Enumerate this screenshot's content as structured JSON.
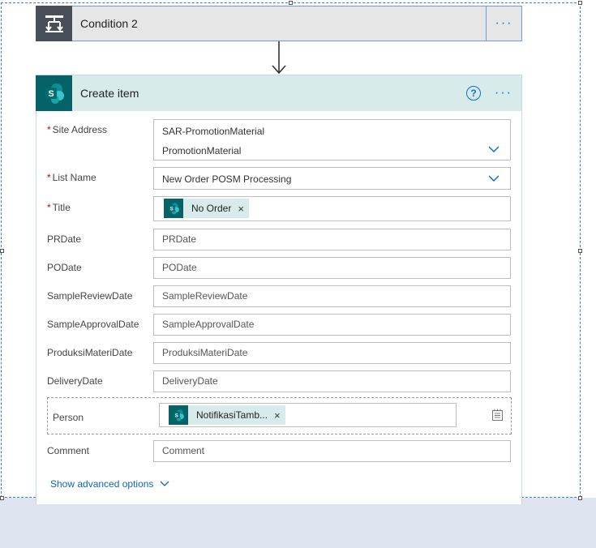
{
  "colors": {
    "accent": "#0e6ed3",
    "sharepoint": "#056367",
    "header_bg": "#d8ebeb",
    "required": "#cc0000"
  },
  "condition": {
    "title": "Condition 2",
    "icon": "condition-icon",
    "more": "···"
  },
  "action": {
    "title": "Create item",
    "icon": "sharepoint-icon",
    "help": "?",
    "more": "···",
    "fields": {
      "site_address": {
        "label": "Site Address",
        "line1": "SAR-PromotionMaterial",
        "line2": "PromotionMaterial"
      },
      "list_name": {
        "label": "List Name",
        "value": "New Order POSM Processing"
      },
      "title": {
        "label": "Title",
        "token": "No Order",
        "remove": "×"
      },
      "prdate": {
        "label": "PRDate",
        "placeholder": "PRDate"
      },
      "podate": {
        "label": "PODate",
        "placeholder": "PODate"
      },
      "sample_review": {
        "label": "SampleReviewDate",
        "placeholder": "SampleReviewDate"
      },
      "sample_approval": {
        "label": "SampleApprovalDate",
        "placeholder": "SampleApprovalDate"
      },
      "produksi": {
        "label": "ProduksiMateriDate",
        "placeholder": "ProduksiMateriDate"
      },
      "delivery": {
        "label": "DeliveryDate",
        "placeholder": "DeliveryDate"
      },
      "person": {
        "label": "Person",
        "token": "NotifikasiTamb...",
        "remove": "×"
      },
      "comment": {
        "label": "Comment",
        "placeholder": "Comment"
      }
    },
    "required_mark": "*",
    "advanced_link": "Show advanced options"
  }
}
